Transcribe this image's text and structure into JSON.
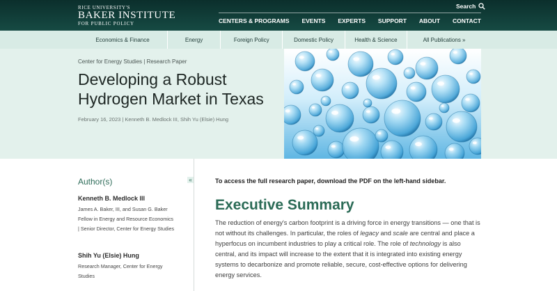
{
  "header": {
    "logo": {
      "line1": "RICE UNIVERSITY'S",
      "line2": "BAKER INSTITUTE",
      "line3": "FOR PUBLIC POLICY"
    },
    "search_label": "Search",
    "nav": [
      "CENTERS & PROGRAMS",
      "EVENTS",
      "EXPERTS",
      "SUPPORT",
      "ABOUT",
      "CONTACT"
    ]
  },
  "subnav": [
    "Economics & Finance",
    "Energy",
    "Foreign Policy",
    "Domestic Policy",
    "Health & Science",
    "All Publications  »"
  ],
  "hero": {
    "kicker": "Center for Energy Studies | Research Paper",
    "title": "Developing a Robust Hydrogen Market in Texas",
    "meta": "February 16, 2023 | Kenneth B. Medlock III, Shih Yu (Elsie) Hung"
  },
  "sidebar": {
    "heading": "Author(s)",
    "collapse_icon": "«",
    "authors": [
      {
        "name": "Kenneth B. Medlock III",
        "role": "James A. Baker, III, and Susan G. Baker Fellow in Energy and Resource Economics | Senior Director, Center for Energy Studies"
      },
      {
        "name": "Shih Yu (Elsie) Hung",
        "role": "Research Manager, Center for Energy Studies"
      }
    ]
  },
  "main": {
    "notice": "To access the full research paper, download the PDF on the left-hand sidebar.",
    "exec_heading": "Executive Summary",
    "para_parts": [
      "The reduction of energy's carbon footprint is a driving force in energy transitions — one that is not without its challenges. In particular, the roles of ",
      "legacy",
      " and ",
      "scale",
      " are central and place a hyperfocus on incumbent industries to play a critical role. The role of ",
      "technology",
      " is also central, and its impact will increase to the extent that it is integrated into existing energy systems to decarbonize and promote reliable, secure, cost-effective options for delivering energy services."
    ]
  },
  "colors": {
    "header_bg": "#0b2f2c",
    "subnav_bg": "#d8ebe5",
    "hero_bg": "#e3f1ec",
    "accent_green": "#2b6b56"
  }
}
